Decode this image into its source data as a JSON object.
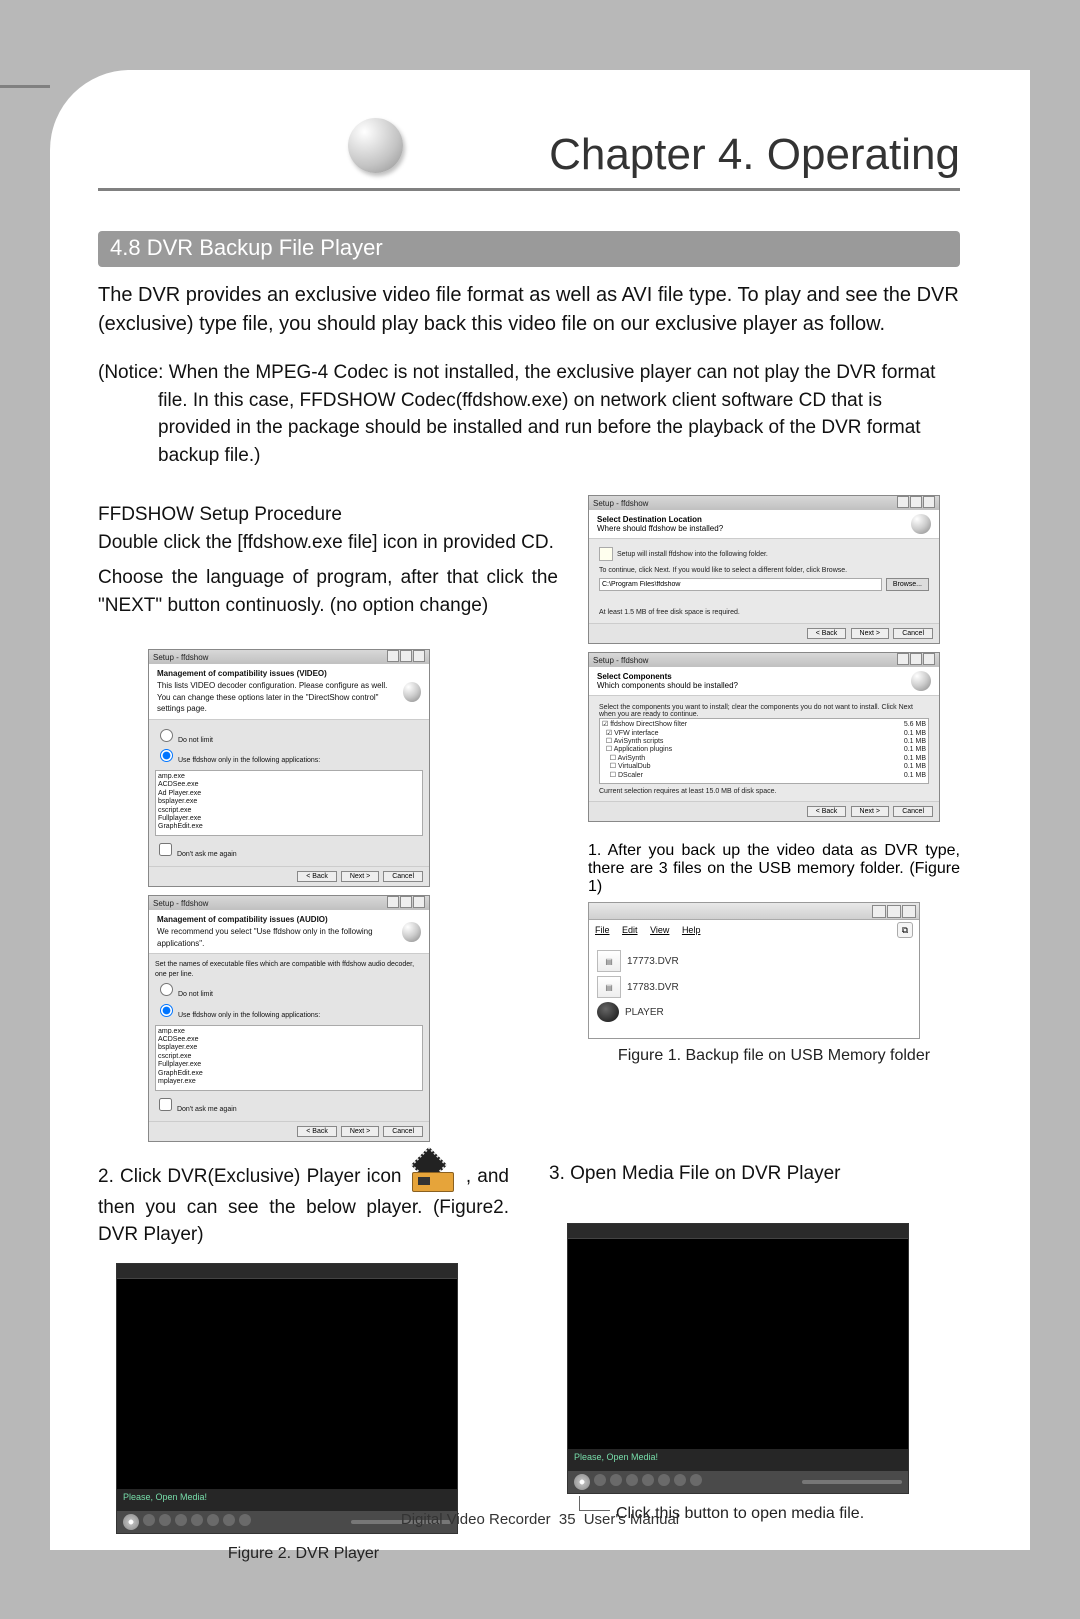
{
  "chapter_title": "Chapter 4. Operating",
  "section_title": "4.8 DVR Backup File Player",
  "intro_para": "The DVR provides an exclusive video file format as well as AVI file type. To play and see the DVR (exclusive) type file, you should play back this video file on our exclusive player as follow.",
  "notice": "(Notice: When the MPEG-4 Codec is not installed, the exclusive player can not play the DVR format file. In this case, FFDSHOW Codec(ffdshow.exe) on network client software CD that is provided in the package should be installed and run before the playback of the DVR format backup file.)",
  "ffdshow_heading": "FFDSHOW Setup Procedure",
  "ffdshow_line1": "Double click the [ffdshow.exe file] icon in provided CD.",
  "ffdshow_line2": "Choose the language of program, after that click the \"NEXT\" button continuosly. (no option change)",
  "installer1": {
    "titlebar": "Setup - ffdshow",
    "header_title": "Select Destination Location",
    "header_sub": "Where should ffdshow be installed?",
    "body_text1": "Setup will install ffdshow into the following folder.",
    "body_text2": "To continue, click Next. If you would like to select a different folder, click Browse.",
    "path": "C:\\Program Files\\ffdshow",
    "browse": "Browse...",
    "space": "At least 1.5 MB of free disk space is required.",
    "buttons": {
      "back": "< Back",
      "next": "Next >",
      "cancel": "Cancel"
    }
  },
  "installer2": {
    "titlebar": "Setup - ffdshow",
    "header_title": "Select Components",
    "header_sub": "Which components should be installed?",
    "body_text": "Select the components you want to install; clear the components you do not want to install. Click Next when you are ready to continue.",
    "components": [
      {
        "name": "ffdshow DirectShow filter",
        "size": "5.6 MB"
      },
      {
        "name": "VFW interface",
        "size": "0.1 MB"
      },
      {
        "name": "AviSynth scripts",
        "size": "0.1 MB"
      },
      {
        "name": "Application plugins",
        "size": "0.1 MB"
      },
      {
        "name": "AviSynth",
        "size": "0.1 MB"
      },
      {
        "name": "VirtualDub",
        "size": "0.1 MB"
      },
      {
        "name": "DScaler",
        "size": "0.1 MB"
      }
    ],
    "space": "Current selection requires at least 15.0 MB of disk space.",
    "buttons": {
      "back": "< Back",
      "next": "Next >",
      "cancel": "Cancel"
    }
  },
  "mgmt1": {
    "titlebar": "Setup - ffdshow",
    "header_title": "Management of compatibility issues (VIDEO)",
    "header_sub": "This lists VIDEO decoder configuration. Please configure as well.",
    "note": "You can change these options later in the \"DirectShow control\" settings page.",
    "opt_none": "Do not limit",
    "opt_use": "Use ffdshow only in the following applications:",
    "apps": [
      "amp.exe",
      "ACDSee.exe",
      "Ad Player.exe",
      "bsplayer.exe",
      "cscript.exe",
      "Fullplayer.exe",
      "GraphEdit.exe"
    ],
    "dontask": "Don't ask me again",
    "buttons": {
      "back": "< Back",
      "next": "Next >",
      "cancel": "Cancel"
    }
  },
  "mgmt2": {
    "titlebar": "Setup - ffdshow",
    "header_title": "Management of compatibility issues (AUDIO)",
    "header_sub": "We recommend you select \"Use ffdshow only in the following applications\".",
    "note": "Set the names of executable files which are compatible with ffdshow audio decoder, one per line.",
    "opt_none": "Do not limit",
    "opt_use": "Use ffdshow only in the following applications:",
    "apps": [
      "amp.exe",
      "ACDSee.exe",
      "bsplayer.exe",
      "cscript.exe",
      "Fullplayer.exe",
      "GraphEdit.exe",
      "mplayer.exe"
    ],
    "dontask": "Don't ask me again",
    "buttons": {
      "back": "< Back",
      "next": "Next >",
      "cancel": "Cancel"
    }
  },
  "step1_text": "1. After you back up the video data as DVR type, there are 3 files on the USB memory folder. (Figure 1)",
  "explorer": {
    "menu_file": "File",
    "menu_edit": "Edit",
    "menu_view": "View",
    "menu_help": "Help",
    "files": [
      "17773.DVR",
      "17783.DVR",
      "PLAYER"
    ]
  },
  "caption1": "Figure 1. Backup file on USB Memory folder",
  "step2_before": "2. Click DVR(Exclusive) Player icon ",
  "step2_after": ", and then you can see the below player. (Figure2. DVR Player)",
  "caption2": "Figure 2. DVR Player",
  "step3_text": "3. Open Media File on DVR Player",
  "callout_text": "Click this button to open media file.",
  "player_status": "Please, Open Media!",
  "footer_left": "Digital Video Recorder",
  "footer_page": "35",
  "footer_right": "User's Manual"
}
